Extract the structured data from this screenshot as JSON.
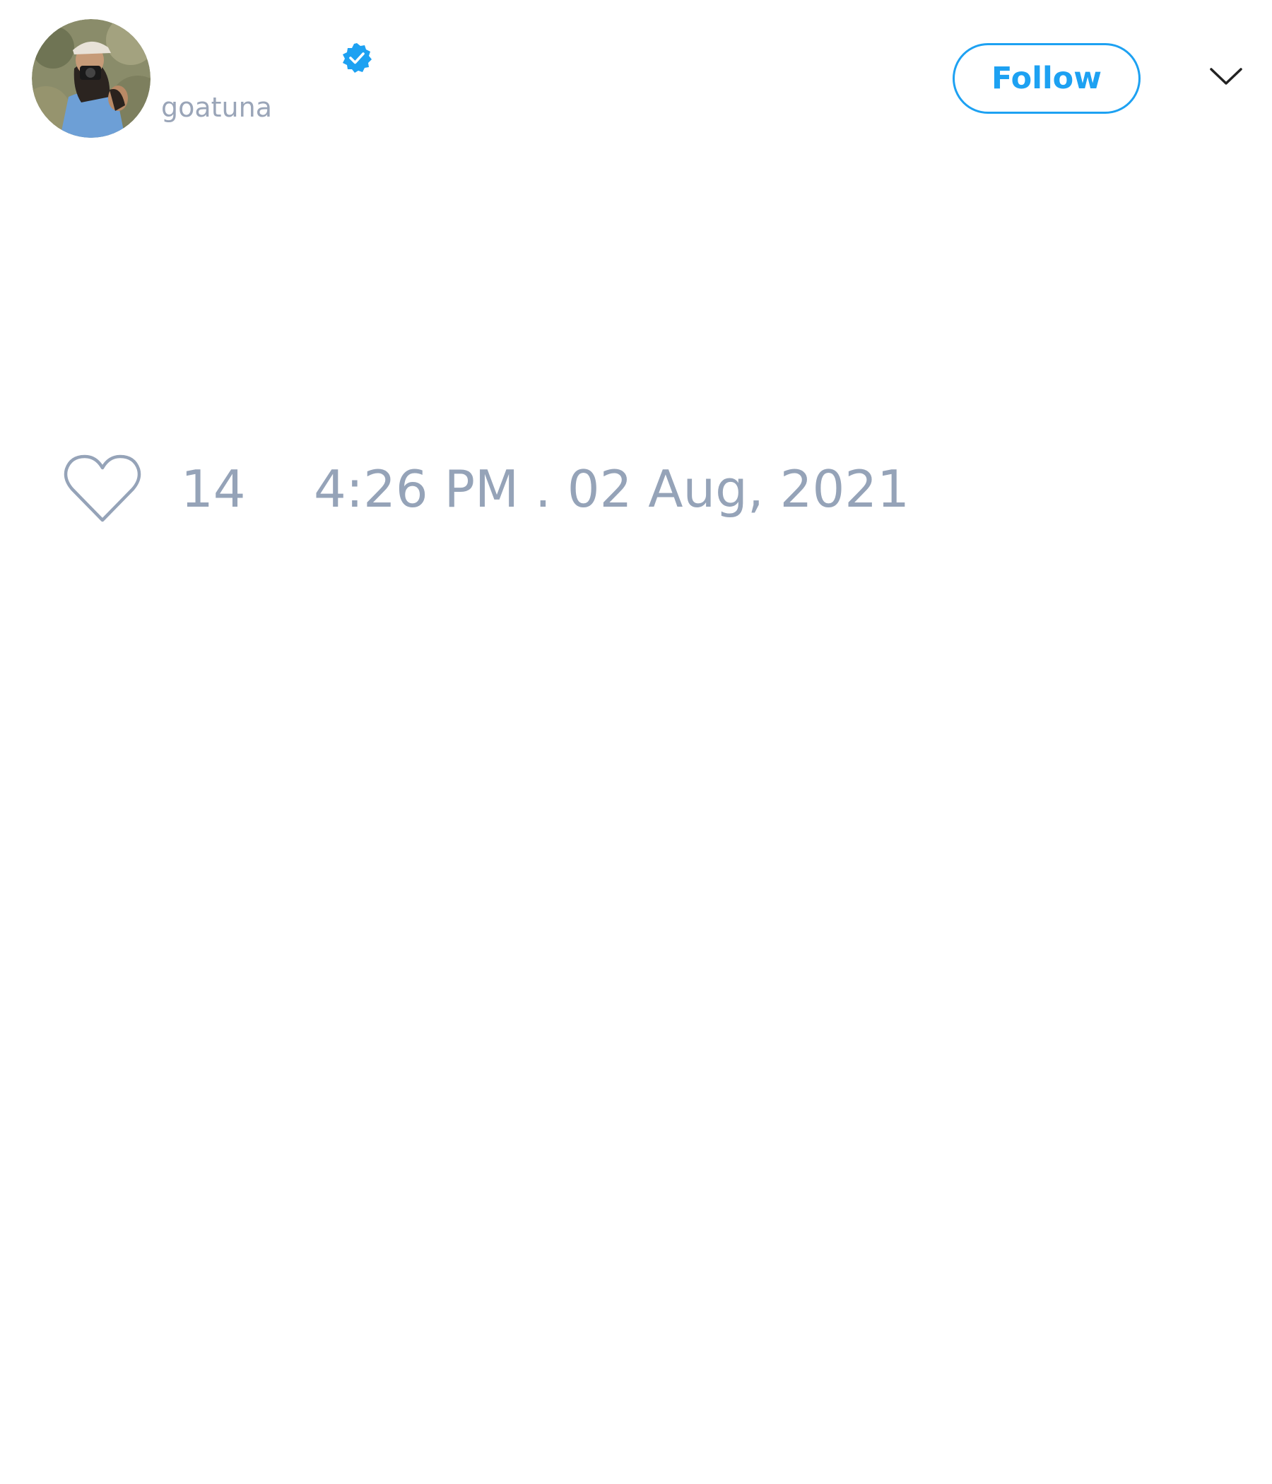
{
  "tweet": {
    "author": {
      "handle": "goatuna",
      "verified": true,
      "avatar": "photo of a person in a cap holding a camera, wearing a light blue shirt"
    },
    "follow_label": "Follow",
    "menu_icon": "chevron-down-icon",
    "likes": {
      "icon": "heart-icon",
      "count": "14"
    },
    "timestamp": "4:26 PM . 02 Aug, 2021"
  },
  "colors": {
    "accent": "#1da1f2",
    "muted_text": "#95a3b8",
    "handle_text": "#9aa5b8",
    "background": "#ffffff"
  }
}
